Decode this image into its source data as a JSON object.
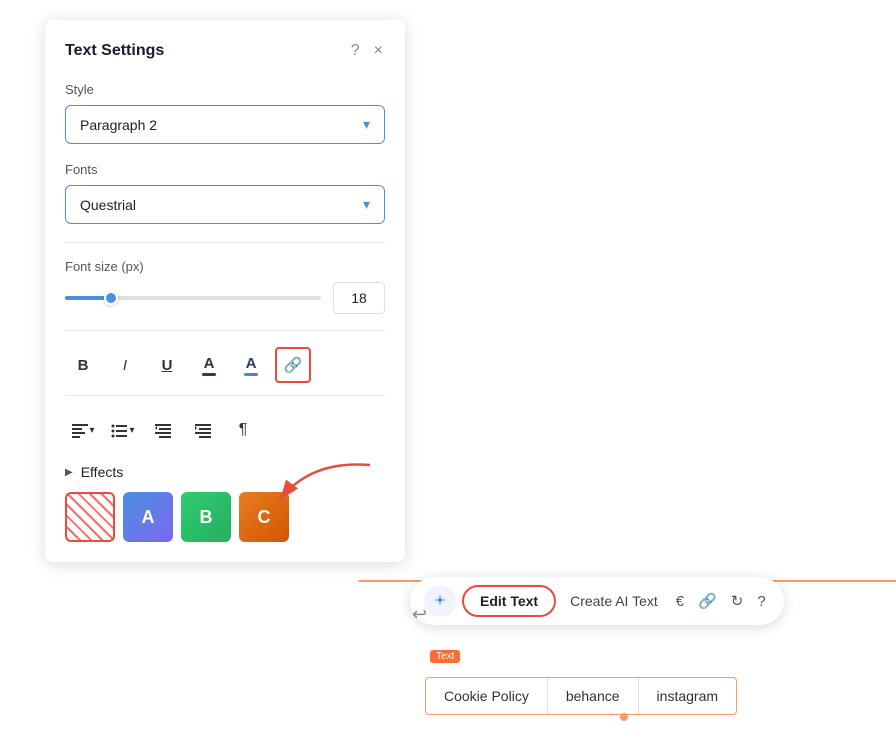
{
  "panel": {
    "title": "Text Settings",
    "help_icon": "?",
    "close_icon": "×",
    "style_label": "Style",
    "style_value": "Paragraph 2",
    "fonts_label": "Fonts",
    "font_value": "Questrial",
    "font_size_label": "Font size (px)",
    "font_size_value": "18",
    "toolbar_buttons": [
      "B",
      "I",
      "U"
    ],
    "effects_label": "Effects"
  },
  "bottom_toolbar": {
    "edit_text_label": "Edit Text",
    "create_ai_label": "Create AI Text",
    "help_label": "?"
  },
  "footer": {
    "items": [
      "Cookie Policy",
      "behance",
      "instagram"
    ]
  },
  "colors": {
    "accent_blue": "#4a90e2",
    "accent_red": "#e74c3c",
    "accent_orange": "#ff9966"
  }
}
